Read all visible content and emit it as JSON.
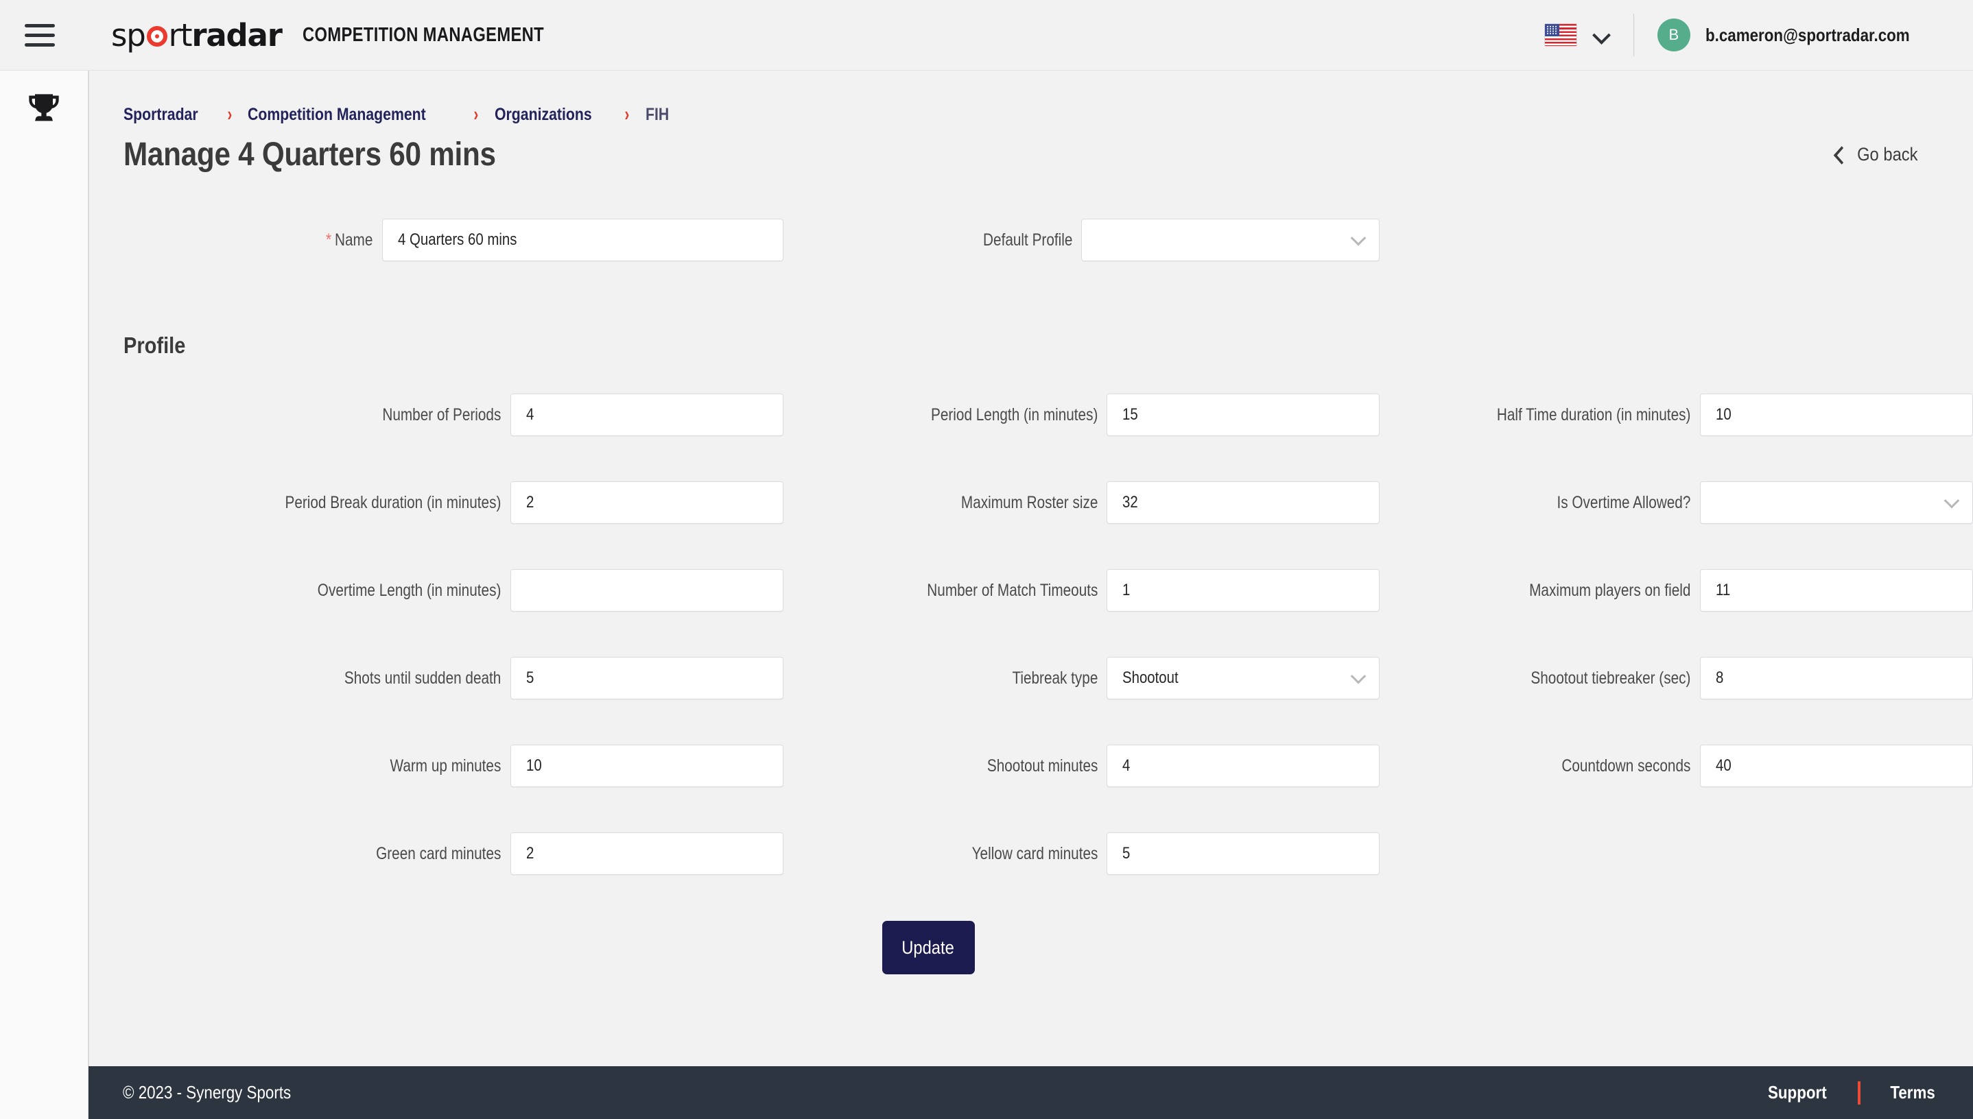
{
  "topbar": {
    "menu_icon": "hamburger-icon",
    "logo_text_pre": "sp",
    "logo_text_mid": "rt",
    "logo_text_bold": "radar",
    "app_title": "COMPETITION MANAGEMENT",
    "language_icon": "us-flag-icon",
    "language_caret": "chevron-down-icon",
    "avatar_initial": "B",
    "user_email": "b.cameron@sportradar.com",
    "avatar_color": "#56ad8b"
  },
  "rail": {
    "items": [
      {
        "icon": "trophy-icon",
        "name": "competitions"
      }
    ],
    "logout_icon": "logout-icon"
  },
  "breadcrumb": {
    "separator": "›",
    "items": [
      {
        "label": "Sportradar",
        "current": false
      },
      {
        "label": "Competition Management",
        "current": false
      },
      {
        "label": "Organizations",
        "current": false
      },
      {
        "label": "FIH",
        "current": true
      }
    ]
  },
  "header": {
    "page_title": "Manage 4 Quarters 60 mins",
    "go_back_label": "Go back",
    "go_back_icon": "chevron-left-icon"
  },
  "form": {
    "name_label": "Name",
    "name_required_mark": "*",
    "name_value": "4 Quarters 60 mins",
    "default_profile_label": "Default Profile",
    "default_profile_value": "",
    "section_title": "Profile",
    "rows": [
      [
        {
          "label": "Number of Periods",
          "value": "4",
          "type": "input"
        },
        {
          "label": "Period Length (in minutes)",
          "value": "15",
          "type": "input"
        },
        {
          "label": "Half Time duration (in minutes)",
          "value": "10",
          "type": "input"
        }
      ],
      [
        {
          "label": "Period Break duration (in minutes)",
          "value": "2",
          "type": "input"
        },
        {
          "label": "Maximum Roster size",
          "value": "32",
          "type": "input"
        },
        {
          "label": "Is Overtime Allowed?",
          "value": "",
          "type": "select"
        }
      ],
      [
        {
          "label": "Overtime Length (in minutes)",
          "value": "",
          "type": "input"
        },
        {
          "label": "Number of Match Timeouts",
          "value": "1",
          "type": "input"
        },
        {
          "label": "Maximum players on field",
          "value": "11",
          "type": "input"
        }
      ],
      [
        {
          "label": "Shots until sudden death",
          "value": "5",
          "type": "input"
        },
        {
          "label": "Tiebreak type",
          "value": "Shootout",
          "type": "select"
        },
        {
          "label": "Shootout tiebreaker (sec)",
          "value": "8",
          "type": "input"
        }
      ],
      [
        {
          "label": "Warm up minutes",
          "value": "10",
          "type": "input"
        },
        {
          "label": "Shootout minutes",
          "value": "4",
          "type": "input"
        },
        {
          "label": "Countdown seconds",
          "value": "40",
          "type": "input"
        }
      ],
      [
        {
          "label": "Green card minutes",
          "value": "2",
          "type": "input"
        },
        {
          "label": "Yellow card minutes",
          "value": "5",
          "type": "input"
        },
        {
          "label": "",
          "value": "",
          "type": "empty"
        }
      ]
    ],
    "submit_label": "Update",
    "submit_color": "#1b1b4f"
  },
  "footer": {
    "copyright": "© 2023 - Synergy Sports",
    "support_label": "Support",
    "terms_label": "Terms",
    "separator_color": "#eb4b34"
  }
}
